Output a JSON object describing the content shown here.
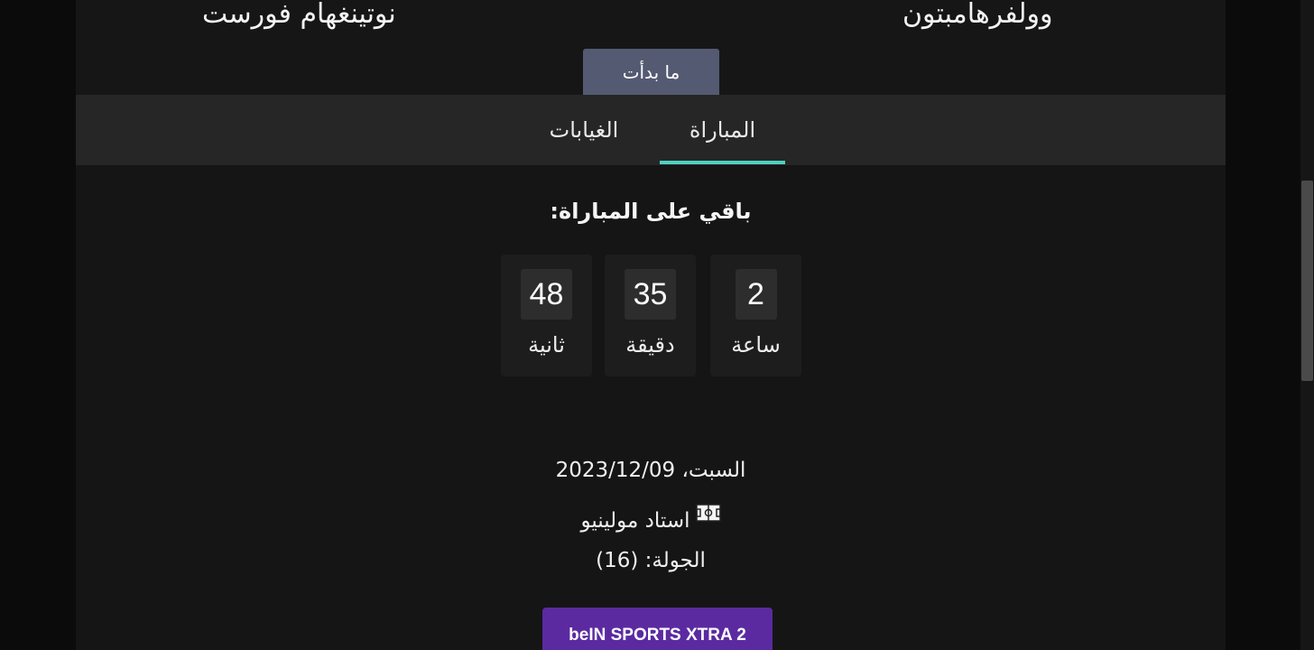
{
  "teams": {
    "home": "وولفرهامبتون",
    "away": "نوتينغهام فورست"
  },
  "match_status": "ما بدأت",
  "tabs": [
    {
      "label": "المباراة",
      "active": true
    },
    {
      "label": "الغيابات",
      "active": false
    }
  ],
  "countdown": {
    "title": "باقي على المباراة:",
    "hours": {
      "value": "2",
      "label": "ساعة"
    },
    "minutes": {
      "value": "35",
      "label": "دقيقة"
    },
    "seconds": {
      "value": "48",
      "label": "ثانية"
    }
  },
  "info": {
    "date": "السبت، 2023/12/09",
    "stadium": "استاد مولينيو",
    "round": "الجولة: (16)"
  },
  "channel": "beIN SPORTS XTRA 2",
  "colors": {
    "accent": "#4fd1bf",
    "status_button": "#545a72",
    "channel_button": "#5b2aa0",
    "background": "#151515"
  },
  "icons": {
    "stadium": "stadium-icon"
  }
}
